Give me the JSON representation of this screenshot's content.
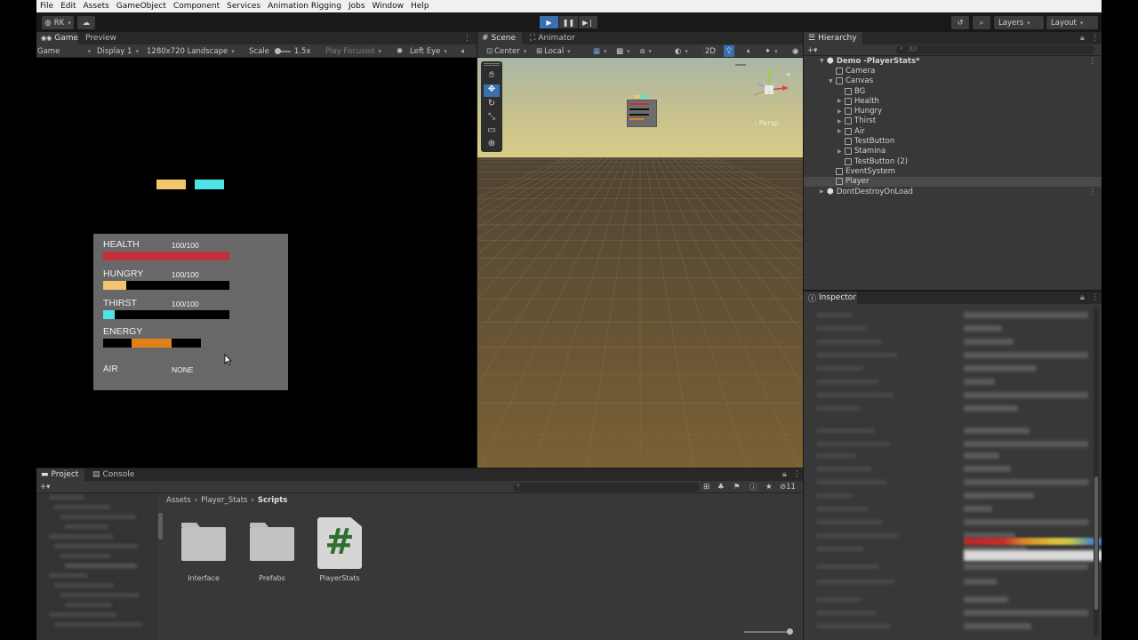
{
  "menu": [
    "File",
    "Edit",
    "Assets",
    "GameObject",
    "Component",
    "Services",
    "Animation Rigging",
    "Jobs",
    "Window",
    "Help"
  ],
  "toolbar": {
    "account": "RK",
    "layers": "Layers",
    "layout": "Layout"
  },
  "game_panel": {
    "tabs": [
      "Game",
      "Preview"
    ],
    "display_mode": "Game",
    "display": "Display 1",
    "resolution": "1280x720 Landscape",
    "scale_label": "Scale",
    "scale_value": "1.5x",
    "play_focused": "Play Focused",
    "eye": "Left Eye"
  },
  "game_ui": {
    "stats": [
      {
        "label": "HEALTH",
        "value": "100/100",
        "fill": 1.0,
        "color": "#c0303b"
      },
      {
        "label": "HUNGRY",
        "value": "100/100",
        "fill": 0.18,
        "color": "#f5c46e"
      },
      {
        "label": "THIRST",
        "value": "100/100",
        "fill": 0.09,
        "color": "#4fe3e6"
      },
      {
        "label": "ENERGY",
        "value": "",
        "fill": 0.41,
        "color": "#e0801a"
      }
    ],
    "air": {
      "label": "AIR",
      "value": "NONE"
    },
    "swatch_colors": [
      "#f5c46e",
      "#4fe3e6"
    ]
  },
  "scene_panel": {
    "tabs": [
      "Scene",
      "Animator"
    ],
    "pivot": "Center",
    "space": "Local",
    "mode_2d": "2D",
    "persp": "Persp"
  },
  "hierarchy": {
    "title": "Hierarchy",
    "search_placeholder": "All",
    "items": [
      {
        "label": "Demo -PlayerStats*",
        "depth": 0,
        "expanded": true,
        "scene": true
      },
      {
        "label": "Camera",
        "depth": 1
      },
      {
        "label": "Canvas",
        "depth": 1,
        "expanded": true
      },
      {
        "label": "BG",
        "depth": 2
      },
      {
        "label": "Health",
        "depth": 2,
        "collapsed": true
      },
      {
        "label": "Hungry",
        "depth": 2,
        "collapsed": true
      },
      {
        "label": "Thirst",
        "depth": 2,
        "collapsed": true
      },
      {
        "label": "Air",
        "depth": 2,
        "collapsed": true
      },
      {
        "label": "TestButton",
        "depth": 2
      },
      {
        "label": "Stamina",
        "depth": 2,
        "collapsed": true
      },
      {
        "label": "TestButton (2)",
        "depth": 2
      },
      {
        "label": "EventSystem",
        "depth": 1
      },
      {
        "label": "Player",
        "depth": 1,
        "selected": true
      },
      {
        "label": "DontDestroyOnLoad",
        "depth": 0,
        "collapsed": true,
        "scene": true
      }
    ]
  },
  "inspector": {
    "title": "Inspector"
  },
  "project_panel": {
    "tabs": [
      "Project",
      "Console"
    ],
    "breadcrumb": [
      "Assets",
      "Player_Stats",
      "Scripts"
    ],
    "badge_count": "11",
    "assets": [
      {
        "name": "Interface",
        "kind": "folder"
      },
      {
        "name": "Prefabs",
        "kind": "folder"
      },
      {
        "name": "PlayerStats",
        "kind": "script",
        "glyph": "#"
      }
    ]
  }
}
